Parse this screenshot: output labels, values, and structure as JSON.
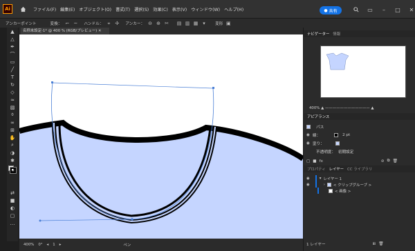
{
  "app": {
    "logo_text": "Ai",
    "menu": [
      "ファイル(F)",
      "編集(E)",
      "オブジェクト(O)",
      "書式(T)",
      "選択(S)",
      "効果(C)",
      "表示(V)",
      "ウィンドウ(W)",
      "ヘルプ(H)"
    ],
    "share_label": "共有",
    "brand_color": "#ff9a00",
    "accent_color": "#1473e6"
  },
  "control_bar": {
    "mode_label": "アンカーポイント",
    "convert_label": "変換：",
    "handle_label": "ハンドル：",
    "anchor_label": "アンカー：",
    "transform_label": "変形"
  },
  "document": {
    "tab_title": "名称未設定-1* @ 400 % (RGB/プレビュー)"
  },
  "status_bar": {
    "zoom": "400%",
    "angle": "0°",
    "page": "1",
    "tool_name": "ペン"
  },
  "panels": {
    "navigator_tab": "ナビゲーター",
    "info_tab": "情報",
    "navigator_zoom": "400%",
    "appearance_tab": "アピアランス",
    "object_type": "パス",
    "stroke_label": "線：",
    "stroke_weight": "2 pt",
    "fill_label": "塗り：",
    "opacity_label": "不透明度：",
    "opacity_value": "初期設定",
    "props_tab": "プロパティ",
    "layers_tab": "レイヤー",
    "libraries_tab": "CC ライブラリ",
    "layer_name": "レイヤー 1",
    "clip_group": "< クリップグループ >",
    "image_item": "< 画像 >",
    "layers_count": "1 レイヤー"
  },
  "colors": {
    "shirt_fill": "#c5d5ff",
    "selection": "#4a7fd6"
  }
}
